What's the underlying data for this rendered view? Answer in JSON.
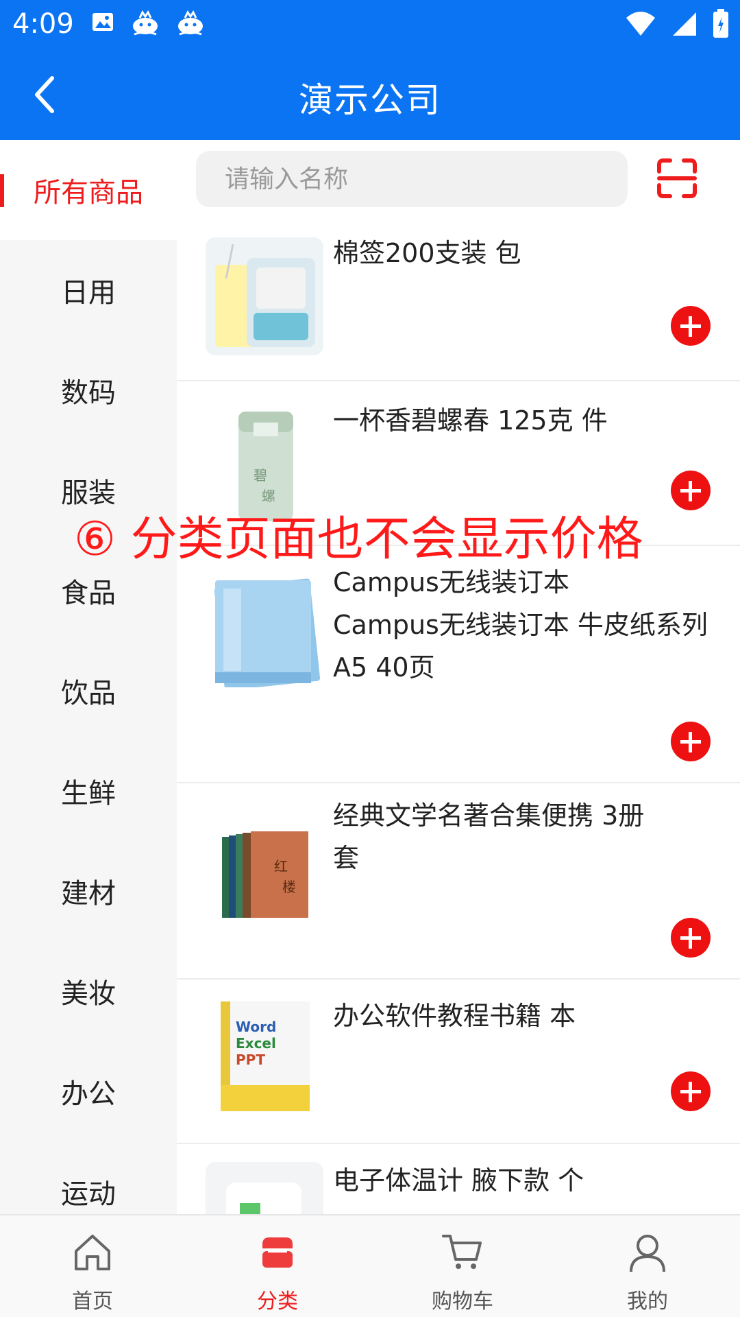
{
  "status_bar": {
    "time": "4:09"
  },
  "header": {
    "title": "演示公司"
  },
  "search": {
    "placeholder": "请输入名称"
  },
  "sidebar": {
    "items": [
      {
        "label": "所有商品",
        "active": true
      },
      {
        "label": "日用"
      },
      {
        "label": "数码"
      },
      {
        "label": "服装"
      },
      {
        "label": "食品"
      },
      {
        "label": "饮品"
      },
      {
        "label": "生鲜"
      },
      {
        "label": "建材"
      },
      {
        "label": "美妆"
      },
      {
        "label": "办公"
      },
      {
        "label": "运动"
      }
    ]
  },
  "products": [
    {
      "name": "棉签200支装 包"
    },
    {
      "name": "一杯香碧螺春 125克 件"
    },
    {
      "name": "Campus无线装订本\n Campus无线装订本 牛皮纸系列 A5 40页"
    },
    {
      "name": "经典文学名著合集便携 3册\n 套"
    },
    {
      "name": "办公软件教程书籍 本"
    },
    {
      "name": "电子体温计 腋下款 个"
    }
  ],
  "overlay_note": "⑥ 分类页面也不会显示价格",
  "bottom_nav": {
    "items": [
      {
        "label": "首页"
      },
      {
        "label": "分类",
        "active": true
      },
      {
        "label": "购物车"
      },
      {
        "label": "我的"
      }
    ]
  },
  "colors": {
    "primary": "#0a74f2",
    "accent": "#ee1c1c",
    "sidebar_bg": "#f6f6f6"
  }
}
